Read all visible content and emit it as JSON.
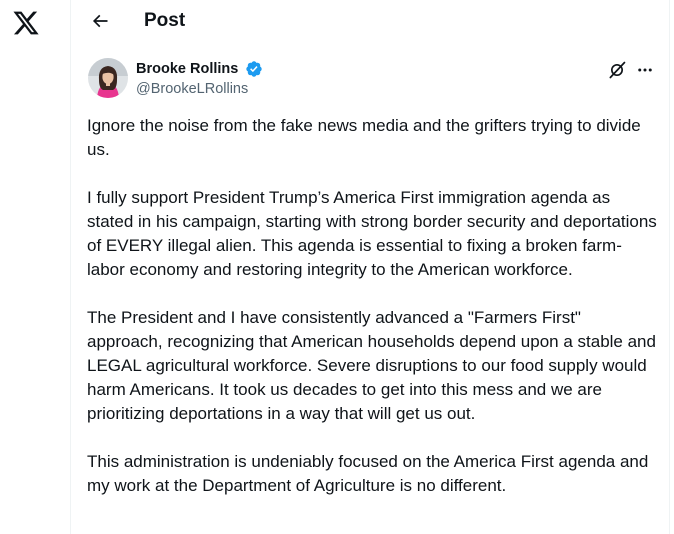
{
  "app": {
    "logo_icon": "x-logo-icon"
  },
  "header": {
    "back_icon": "arrow-left-icon",
    "title": "Post"
  },
  "post": {
    "author": {
      "name": "Brooke Rollins",
      "handle": "@BrookeLRollins",
      "verified": true,
      "verified_color": "#1d9bf0"
    },
    "actions": {
      "grok_icon": "grok-icon",
      "more_icon": "more-options-icon"
    },
    "paragraphs": [
      "Ignore the noise from the fake news media and the grifters trying to divide us.",
      "I fully support President Trump’s America First immigration agenda as stated in his campaign, starting with strong border security and deportations of EVERY illegal alien. This agenda is essential to fixing a broken farm-labor economy and restoring integrity to the American workforce.",
      "The President and I have consistently advanced a \"Farmers First\" approach, recognizing that American households depend upon a stable and LEGAL agricultural workforce. Severe disruptions to our food supply would harm Americans. It took us decades to get into this mess and we are prioritizing deportations in a way that will get us out.",
      "This administration is undeniably focused on the America First agenda and my work at the Department of Agriculture is no different."
    ]
  },
  "colors": {
    "text_primary": "#0f1419",
    "text_secondary": "#536471",
    "border": "#eff3f4",
    "accent": "#1d9bf0"
  }
}
